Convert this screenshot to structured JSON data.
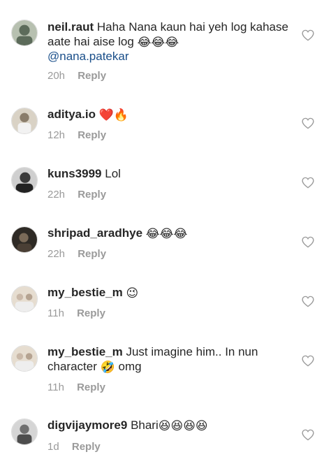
{
  "comments": [
    {
      "username": "neil.raut",
      "text": "Haha Nana kaun hai yeh log kahase aate hai aise log",
      "emojis": "😂😂😂",
      "mention": "@nana.patekar",
      "time": "20h",
      "reply": "Reply",
      "avatar_color": "#5c6b5a"
    },
    {
      "username": "aditya.io",
      "text": "",
      "emojis": "❤️🔥",
      "time": "12h",
      "reply": "Reply",
      "avatar_color": "#8a7d6b"
    },
    {
      "username": "kuns3999",
      "text": "Lol",
      "emojis": "",
      "time": "22h",
      "reply": "Reply",
      "avatar_color": "#3a3a3a"
    },
    {
      "username": "shripad_aradhye",
      "text": "",
      "emojis": "😂😂😂",
      "time": "22h",
      "reply": "Reply",
      "avatar_color": "#4a3f35"
    },
    {
      "username": "my_bestie_m",
      "text": "",
      "emojis": "😉",
      "time": "11h",
      "reply": "Reply",
      "avatar_color": "#c9b8a8"
    },
    {
      "username": "my_bestie_m",
      "text": "Just imagine him.. In nun character",
      "emojis": "🤣",
      "text_after": "omg",
      "time": "11h",
      "reply": "Reply",
      "avatar_color": "#c9b8a8"
    },
    {
      "username": "digvijaymore9",
      "text": "Bhari",
      "emojis": "😆😆😆😆",
      "time": "1d",
      "reply": "Reply",
      "avatar_color": "#6f6f6f"
    }
  ],
  "icons": {
    "like": "heart-outline-icon"
  }
}
